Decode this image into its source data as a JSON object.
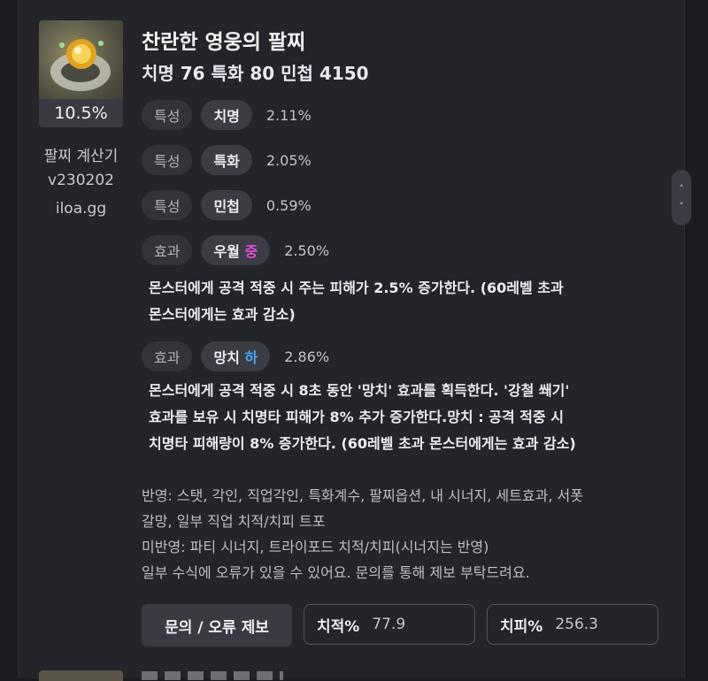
{
  "item": {
    "name": "찬란한 영웅의 팔찌",
    "stats_summary": "치명 76  특화 80  민첩 4150",
    "percent": "10.5%"
  },
  "sidebar": {
    "calc_name": "팔찌 계산기",
    "version": "v230202",
    "site": "iloa.gg"
  },
  "options": [
    {
      "type": "특성",
      "name": "치명",
      "grade": "",
      "value": "2.11%"
    },
    {
      "type": "특성",
      "name": "특화",
      "grade": "",
      "value": "2.05%"
    },
    {
      "type": "특성",
      "name": "민첩",
      "grade": "",
      "value": "0.59%"
    },
    {
      "type": "효과",
      "name": "우월",
      "grade": "중",
      "value": "2.50%",
      "grade_color": "#e04cd9",
      "desc_lines": [
        "몬스터에게 공격 적중 시 주는 피해가 2.5% 증가한다. (60레벨 초과",
        "몬스터에게는 효과 감소)"
      ]
    },
    {
      "type": "효과",
      "name": "망치",
      "grade": "하",
      "value": "2.86%",
      "grade_color": "#3fa9f5",
      "desc_lines": [
        "몬스터에게 공격 적중 시 8초 동안 '망치' 효과를 획득한다. '강철 쐐기'",
        "효과를 보유 시 치명타 피해가 8% 추가 증가한다.망치 : 공격 적중 시",
        "치명타 피해량이 8% 증가한다. (60레벨 초과 몬스터에게는 효과 감소)"
      ]
    }
  ],
  "notes": [
    "반영: 스탯, 각인, 직업각인, 특화계수, 팔찌옵션, 내 시너지, 세트효과, 서폿",
    "갈망, 일부 직업 치적/치피 트포",
    "미반영: 파티 시너지, 트라이포드 치적/치피(시너지는 반영)",
    "일부 수식에 오류가 있을 수 있어요. 문의를 통해 제보 부탁드려요."
  ],
  "footer": {
    "report_button": "문의 / 오류 제보",
    "crit_rate_label": "치적%",
    "crit_rate_value": "77.9",
    "crit_dmg_label": "치피%",
    "crit_dmg_value": "256.3"
  },
  "scroll": {
    "up_icon": "chevron-up-icon",
    "down_icon": "chevron-down-icon"
  }
}
